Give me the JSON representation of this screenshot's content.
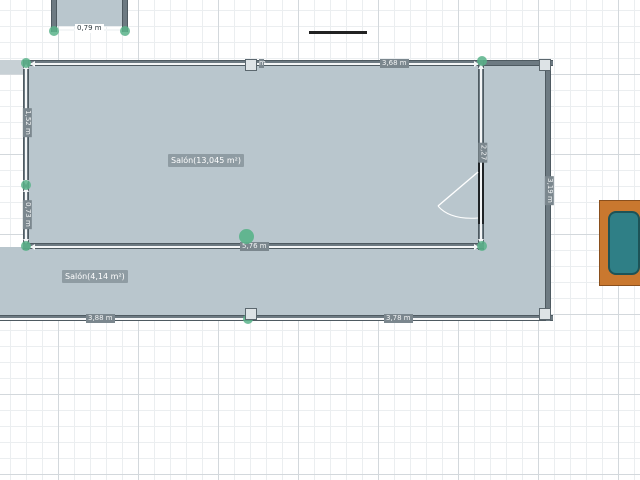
{
  "rooms": [
    {
      "name": "Salón(13,045 m²)"
    },
    {
      "name": "Salón(4,14 m²)"
    }
  ],
  "dimensions": {
    "top_room_width": "0,79 m",
    "top_wall": "3,68 m",
    "left_upper": "1,52 m",
    "left_lower": "0,73 m",
    "inner_bottom": "5,76 m",
    "inner_right": "2,27",
    "outer_right": "3,19 m",
    "bottom_left": "3,88 m",
    "bottom_right": "3,78 m"
  },
  "colors": {
    "floor": "#b9c6cd",
    "wall": "#6d7a82",
    "node": "#59b38a",
    "furniture_frame": "#c9782f",
    "furniture_fill": "#2f7f86"
  },
  "icons": {
    "door": "door-swing-icon",
    "furniture": "bathtub-icon",
    "toolbar": "minus-line-icon"
  }
}
